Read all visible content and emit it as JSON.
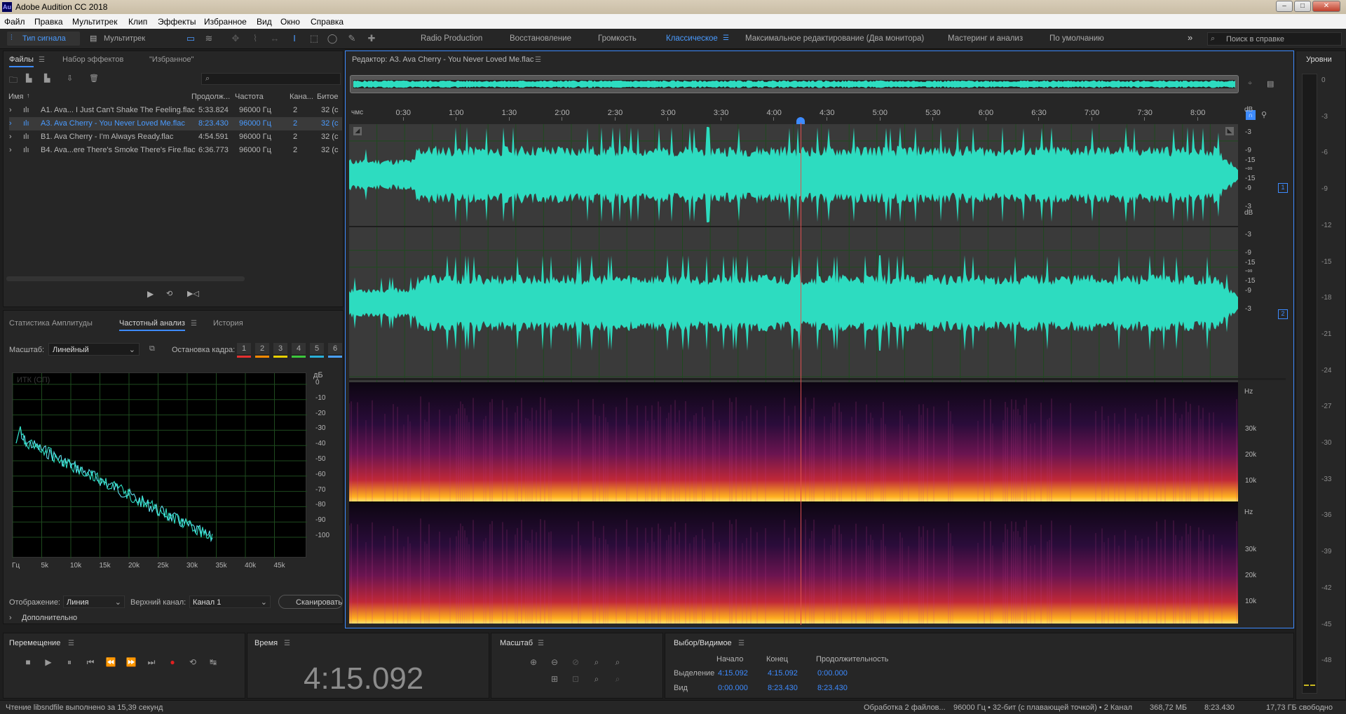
{
  "window": {
    "title": "Adobe Audition CC 2018",
    "logo": "Au"
  },
  "menu": [
    "Файл",
    "Правка",
    "Мультитрек",
    "Клип",
    "Эффекты",
    "Избранное",
    "Вид",
    "Окно",
    "Справка"
  ],
  "toolbar": {
    "mode_waveform": "Тип сигнала",
    "mode_multitrack": "Мультитрек",
    "workspaces": [
      "Radio Production",
      "Восстановление",
      "Громкость",
      "Классическое",
      "Максимальное редактирование (Два монитора)",
      "Мастеринг и анализ",
      "По умолчанию"
    ],
    "active_workspace": "Классическое",
    "help_search_placeholder": "Поиск в справке"
  },
  "files_panel": {
    "tabs": [
      "Файлы",
      "Набор эффектов",
      "\"Избранное\""
    ],
    "columns": [
      "Имя",
      "Продолж...",
      "Частота",
      "Кана...",
      "Битое"
    ],
    "rows": [
      {
        "name": "A1. Ava... I Just Can't Shake The Feeling.flac",
        "duration": "5:33.824",
        "rate": "96000 Гц",
        "channels": "2",
        "bits": "32 (с"
      },
      {
        "name": "A3. Ava Cherry - You Never Loved Me.flac",
        "duration": "8:23.430",
        "rate": "96000 Гц",
        "channels": "2",
        "bits": "32 (с"
      },
      {
        "name": "B1. Ava Cherry - I'm Always Ready.flac",
        "duration": "4:54.591",
        "rate": "96000 Гц",
        "channels": "2",
        "bits": "32 (с"
      },
      {
        "name": "B4. Ava...ere There's Smoke There's Fire.flac",
        "duration": "6:36.773",
        "rate": "96000 Гц",
        "channels": "2",
        "bits": "32 (с"
      }
    ],
    "selected_row": 1
  },
  "analysis_panel": {
    "tabs": [
      "Статистика Амплитуды",
      "Частотный анализ",
      "История"
    ],
    "scale_label": "Масштаб:",
    "scale_value": "Линейный",
    "hold_label": "Остановка кадра:",
    "hold_slots": [
      "1",
      "2",
      "3",
      "4",
      "5",
      "6"
    ],
    "hold_colors": [
      "#e53030",
      "#ff8a00",
      "#e8d000",
      "#3cc83c",
      "#2ab0d8",
      "#4aa0ff"
    ],
    "graph_label": "ИТК (СП)",
    "db_unit": "дБ",
    "db_ticks": [
      "0",
      "-10",
      "-20",
      "-30",
      "-40",
      "-50",
      "-60",
      "-70",
      "-80",
      "-90",
      "-100"
    ],
    "freq_ticks": [
      "Гц",
      "5k",
      "10k",
      "15k",
      "20k",
      "25k",
      "30k",
      "35k",
      "40k",
      "45k"
    ],
    "display_label": "Отображение:",
    "display_value": "Линия",
    "channel_label": "Верхний канал:",
    "channel_value": "Канал 1",
    "scan_button": "Сканировать",
    "more": "Дополнительно"
  },
  "editor": {
    "title": "Редактор: A3. Ava Cherry - You Never Loved Me.flac",
    "time_unit": "чмс",
    "time_ticks": [
      "0:30",
      "1:00",
      "1:30",
      "2:00",
      "2:30",
      "3:00",
      "3:30",
      "4:00",
      "4:30",
      "5:00",
      "5:30",
      "6:00",
      "6:30",
      "7:00",
      "7:30",
      "8:00"
    ],
    "playhead_seconds": 255.092,
    "total_seconds": 503.43,
    "db_unit": "dB",
    "db_ticks": [
      "-3",
      "-9",
      "-15",
      "-∞",
      "-15",
      "-9",
      "-3"
    ],
    "channel_badges": [
      "1",
      "2"
    ],
    "hz_unit": "Hz",
    "hz_ticks": [
      "30k",
      "20k",
      "10k"
    ]
  },
  "levels": {
    "title": "Уровни",
    "ticks": [
      "0",
      "-3",
      "-6",
      "-9",
      "-12",
      "-15",
      "-18",
      "-21",
      "-24",
      "-27",
      "-30",
      "-33",
      "-36",
      "-39",
      "-42",
      "-45",
      "-48"
    ]
  },
  "transport": {
    "title": "Перемещение"
  },
  "time_panel": {
    "title": "Время",
    "value": "4:15.092"
  },
  "zoom_panel": {
    "title": "Масштаб"
  },
  "selection_panel": {
    "title": "Выбор/Видимое",
    "col_start": "Начало",
    "col_end": "Конец",
    "col_dur": "Продолжительность",
    "sel_label": "Выделение",
    "sel_start": "4:15.092",
    "sel_end": "4:15.092",
    "sel_dur": "0:00.000",
    "view_label": "Вид",
    "view_start": "0:00.000",
    "view_end": "8:23.430",
    "view_dur": "8:23.430"
  },
  "status": {
    "left": "Чтение libsndfile выполнено за 15,39 секунд",
    "processing": "Обработка 2 файлов...",
    "format": "96000 Гц • 32-бит (с плавающей точкой) • 2 Канал",
    "size": "368,72 МБ",
    "duration": "8:23.430",
    "free": "17,73 ГБ свободно"
  },
  "colors": {
    "waveform": "#2ddcc0",
    "accent": "#3d8bff",
    "playhead": "#e05050",
    "record": "#e02020"
  }
}
